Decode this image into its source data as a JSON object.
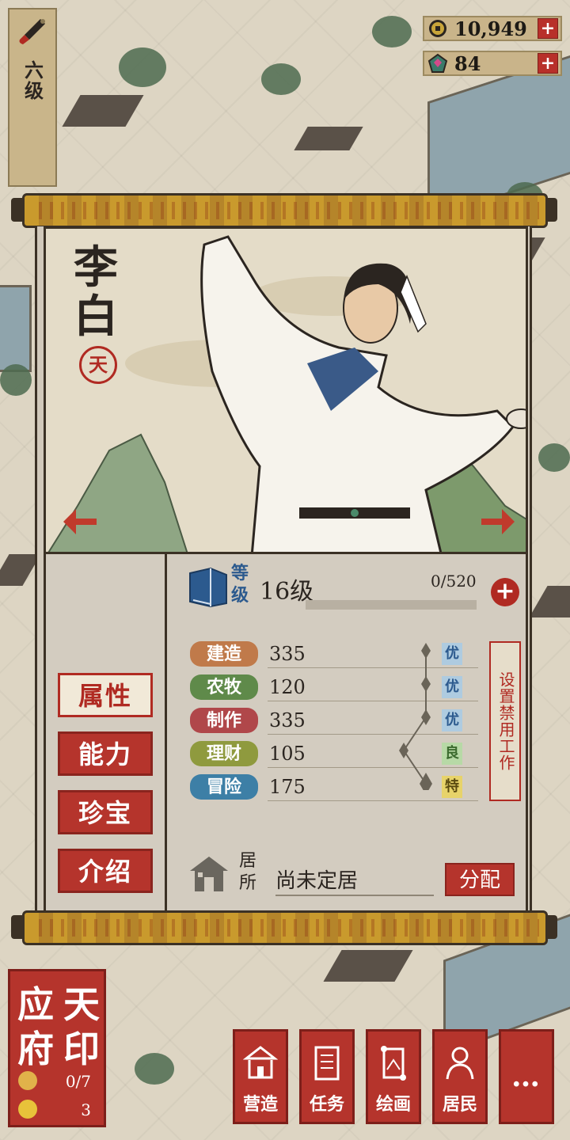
{
  "player": {
    "level_label": "六级"
  },
  "currency": [
    {
      "name": "coins",
      "icon": "coin-icon",
      "value": "10,949"
    },
    {
      "name": "jade",
      "icon": "jade-icon",
      "value": "84"
    }
  ],
  "character": {
    "name": "李白",
    "seal_char": "天",
    "level": {
      "label": "等级",
      "value": "16级",
      "exp": "0/520",
      "exp_fraction": 0
    },
    "skills": [
      {
        "name": "建造",
        "value": "335",
        "grade": "优",
        "color": "#c07a4a",
        "grade_bg": "#aecbe0",
        "grade_color": "#2c5a8e"
      },
      {
        "name": "农牧",
        "value": "120",
        "grade": "优",
        "color": "#5f8a4a",
        "grade_bg": "#aecbe0",
        "grade_color": "#2c5a8e"
      },
      {
        "name": "制作",
        "value": "335",
        "grade": "优",
        "color": "#b0474a",
        "grade_bg": "#aecbe0",
        "grade_color": "#2c5a8e"
      },
      {
        "name": "理财",
        "value": "105",
        "grade": "良",
        "color": "#8f9a3e",
        "grade_bg": "#b7d9a6",
        "grade_color": "#3b6a2e"
      },
      {
        "name": "冒险",
        "value": "175",
        "grade": "特",
        "color": "#3d7fa6",
        "grade_bg": "#e7d36a",
        "grade_color": "#5a4a10"
      }
    ],
    "ban_work_label": "设置禁用工作",
    "residence": {
      "label": "居所",
      "value": "尚未定居",
      "assign_label": "分配"
    }
  },
  "tabs": [
    {
      "label": "属性",
      "active": true
    },
    {
      "label": "能力",
      "active": false
    },
    {
      "label": "珍宝",
      "active": false
    },
    {
      "label": "介绍",
      "active": false
    }
  ],
  "city": {
    "chars": [
      "应",
      "天",
      "府",
      "印"
    ],
    "stats": [
      {
        "icon": "resident-icon",
        "value": "0/7"
      },
      {
        "icon": "happiness-icon",
        "value": "3"
      }
    ]
  },
  "menu": [
    {
      "label": "营造",
      "icon": "building-icon"
    },
    {
      "label": "任务",
      "icon": "task-scroll-icon"
    },
    {
      "label": "绘画",
      "icon": "painting-scroll-icon"
    },
    {
      "label": "居民",
      "icon": "resident-portrait-icon"
    },
    {
      "label": "…",
      "icon": "more-icon"
    }
  ],
  "colors": {
    "accent_red": "#b5342c",
    "ink": "#2b2520",
    "paper": "#e4dcc8",
    "level_blue": "#2c5a8e"
  }
}
